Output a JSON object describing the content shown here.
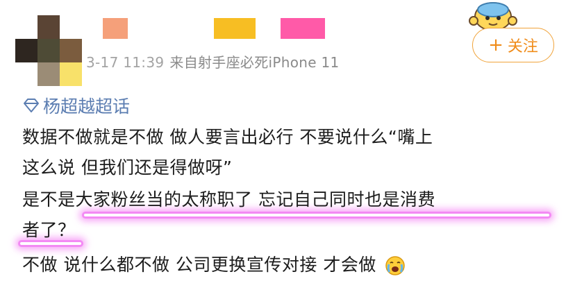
{
  "header": {
    "timestamp": "3-17 11:39",
    "source_prefix": "来自",
    "source_device": "射手座必死iPhone 11",
    "follow_label": "关注",
    "follow_plus": "+"
  },
  "avatar": {
    "mosaic_colors": [
      "#ffffff",
      "#5a4434",
      "#ffffff",
      "#5c4d3a",
      "#4e4b36",
      "#7b5c3e",
      "#ffffff",
      "#9b8c76",
      "#f8e16a"
    ]
  },
  "redactions": {
    "colors": [
      "#f5a07a",
      "#f7be23",
      "#ff5aa8"
    ]
  },
  "topic": {
    "icon": "diamond-icon",
    "label": "杨超越超话"
  },
  "post": {
    "line1": "数据不做就是不做 做人要言出必行 不要说什么“嘴上",
    "line2": "这么说 但我们还是得做呀”",
    "line3": "是不是大家粉丝当的太称职了 忘记自己同时也是消费",
    "line4": "者了？",
    "line5": "不做 说什么都不做 公司更换宣传对接 才会做",
    "emoji": "crying-face-icon"
  },
  "colors": {
    "accent": "#f08c1a",
    "topic": "#5b7db1",
    "highlight": "#f38af4"
  }
}
